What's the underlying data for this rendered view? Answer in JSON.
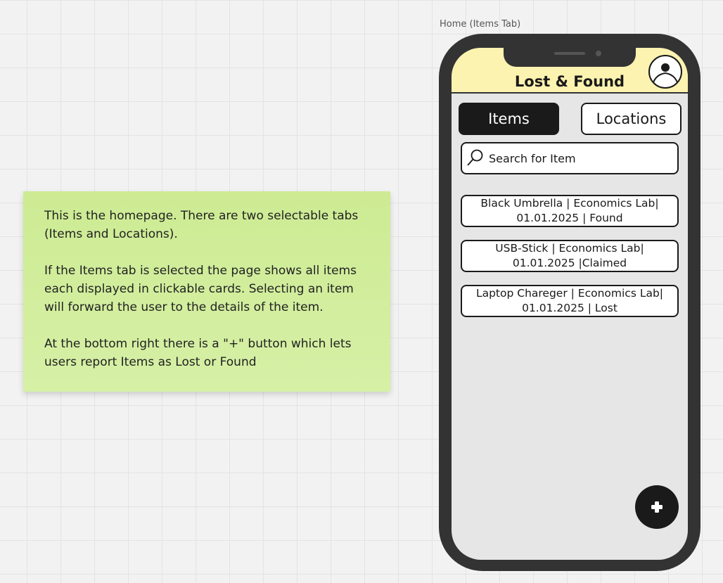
{
  "frame_label": "Home (Items Tab)",
  "note": {
    "paragraphs": [
      "This is the homepage. There are two selectable tabs (Items and Locations).",
      "If the Items tab is selected the page shows all items each displayed in clickable cards.  Selecting an item will forward the user to the details of the item.",
      "At the bottom right there is a \"+\" button which lets users report Items as Lost or Found"
    ]
  },
  "app": {
    "title": "Lost & Found",
    "tabs": [
      {
        "label": "Items",
        "active": true
      },
      {
        "label": "Locations",
        "active": false
      }
    ],
    "search": {
      "placeholder": "Search for Item"
    },
    "items": [
      {
        "text": "Black Umbrella | Economics Lab| 01.01.2025 | Found"
      },
      {
        "text": "USB-Stick | Economics Lab| 01.01.2025 |Claimed"
      },
      {
        "text": "Laptop Chareger | Economics Lab| 01.01.2025 | Lost"
      }
    ],
    "fab_icon": "plus-icon"
  }
}
